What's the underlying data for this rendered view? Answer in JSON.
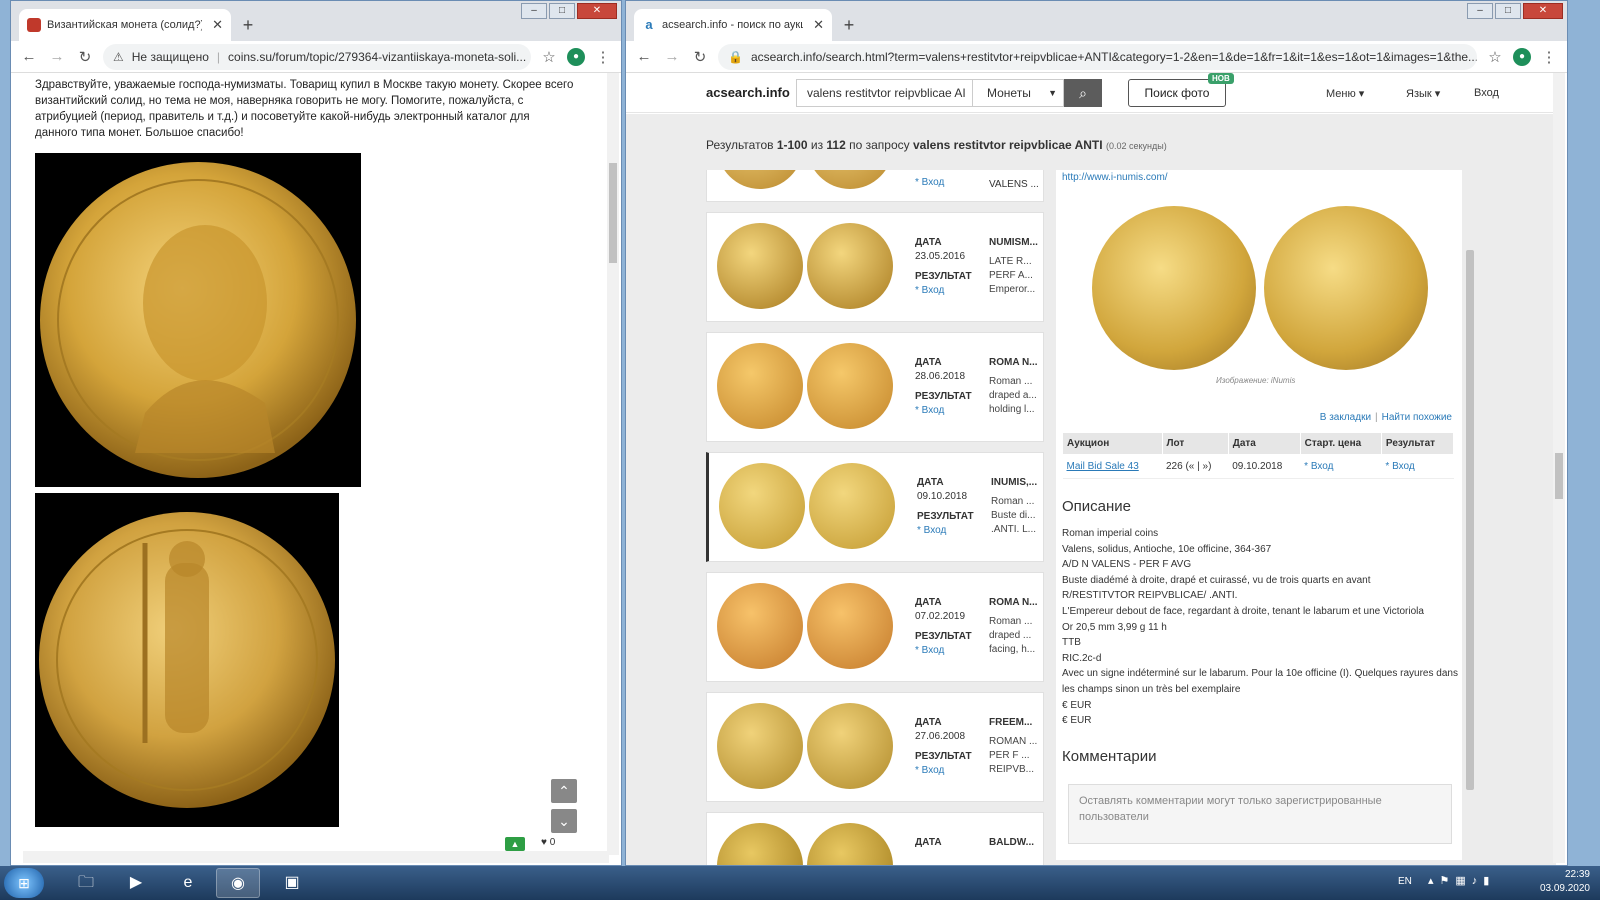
{
  "left_window": {
    "tab_title": "Византийская монета (солид?).",
    "address_warning": "Не защищено",
    "url": "coins.su/forum/topic/279364-vizantiiskaya-moneta-soli...",
    "post_text": "Здравствуйте, уважаемые господа-нумизматы. Товарищ купил в Москве такую монету. Скорее всего византийский солид, но тема не моя, наверняка говорить не могу. Помогите, пожалуйста, с атрибуцией (период, правитель и т.д.) и посоветуйте какой-нибудь электронный каталог для данного типа монет. Большое спасибо!",
    "like_count": "0"
  },
  "right_window": {
    "tab_title": "acsearch.info - поиск по аукцио",
    "url": "acsearch.info/search.html?term=valens+restitvtor+reipvblicae+ANTI&category=1-2&en=1&de=1&fr=1&it=1&es=1&ot=1&images=1&the...",
    "logo": "acsearch.info",
    "search_value": "valens restitvtor reipvblicae AI",
    "category": "Монеты",
    "photo_search": "Поиск фото",
    "new_badge": "НОВ",
    "menu": "Меню",
    "language": "Язык",
    "login": "Вход",
    "results": {
      "prefix": "Результатов ",
      "range": "1-100",
      "of": " из ",
      "total": "112",
      "query_prefix": " по запросу ",
      "query": "valens restitvtor reipvblicae ANTI",
      "time": "(0.02 секунды)"
    },
    "cards": [
      {
        "date_label": "ДАТА",
        "date": "23.05.2016",
        "result_label": "РЕЗУЛЬТАТ",
        "login": "* Вход",
        "auction": "NUMISM...",
        "desc": "LATE R... PERF A... Emperor..."
      },
      {
        "date_label": "ДАТА",
        "date": "28.06.2018",
        "result_label": "РЕЗУЛЬТАТ",
        "login": "* Вход",
        "auction": "ROMA N...",
        "desc": "Roman ... draped a... holding l..."
      },
      {
        "date_label": "ДАТА",
        "date": "09.10.2018",
        "result_label": "РЕЗУЛЬТАТ",
        "login": "* Вход",
        "auction": "INUMIS,...",
        "desc": "Roman ... Buste di... .ANTI. L..."
      },
      {
        "date_label": "ДАТА",
        "date": "07.02.2019",
        "result_label": "РЕЗУЛЬТАТ",
        "login": "* Вход",
        "auction": "ROMA N...",
        "desc": "Roman ... draped ... facing, h..."
      },
      {
        "date_label": "ДАТА",
        "date": "27.06.2008",
        "result_label": "РЕЗУЛЬТАТ",
        "login": "* Вход",
        "auction": "FREEM...",
        "desc": "ROMAN ... PER F ... REIPVB..."
      },
      {
        "date_label": "ДАТА",
        "date": "",
        "result_label": "",
        "login": "",
        "auction": "BALDW...",
        "desc": ""
      }
    ],
    "top_card": {
      "login": "* Вход",
      "auction": "VALENS ..."
    },
    "detail": {
      "link": "http://www.i-numis.com/",
      "credit": "Изображение: iNumis",
      "bookmark": "В закладки",
      "find_similar": "Найти похожие",
      "table_headers": [
        "Аукцион",
        "Лот",
        "Дата",
        "Старт. цена",
        "Результат"
      ],
      "table_row": {
        "auction": "Mail Bid Sale 43",
        "lot": "226 (« | »)",
        "date": "09.10.2018",
        "start": "* Вход",
        "result": "* Вход"
      },
      "description_title": "Описание",
      "description_lines": [
        "Roman imperial coins",
        "Valens, solidus, Antioche, 10e officine, 364-367",
        "A/D N VALENS - PER F AVG",
        "Buste diadémé à droite, drapé et cuirassé, vu de trois quarts en avant",
        "R/RESTITVTOR REIPVBLICAE/ .ANTI.",
        "L'Empereur debout de face, regardant à droite, tenant le labarum et une Victoriola",
        "Or 20,5 mm 3,99 g 11 h",
        "TTB",
        "RIC.2c-d",
        "Avec un signe indéterminé sur le labarum. Pour la 10e officine (I). Quelques rayures dans les champs sinon un très bel exemplaire",
        "€ EUR",
        "€ EUR"
      ],
      "comments_title": "Комментарии",
      "comment_placeholder": "Оставлять комментарии могут только зарегистрированные пользователи"
    }
  },
  "taskbar": {
    "lang": "EN",
    "time": "22:39",
    "date": "03.09.2020"
  },
  "colors": {
    "link": "#2a7ab8",
    "gold": "#d4a43a",
    "taskbar": "#1d3a5c"
  }
}
